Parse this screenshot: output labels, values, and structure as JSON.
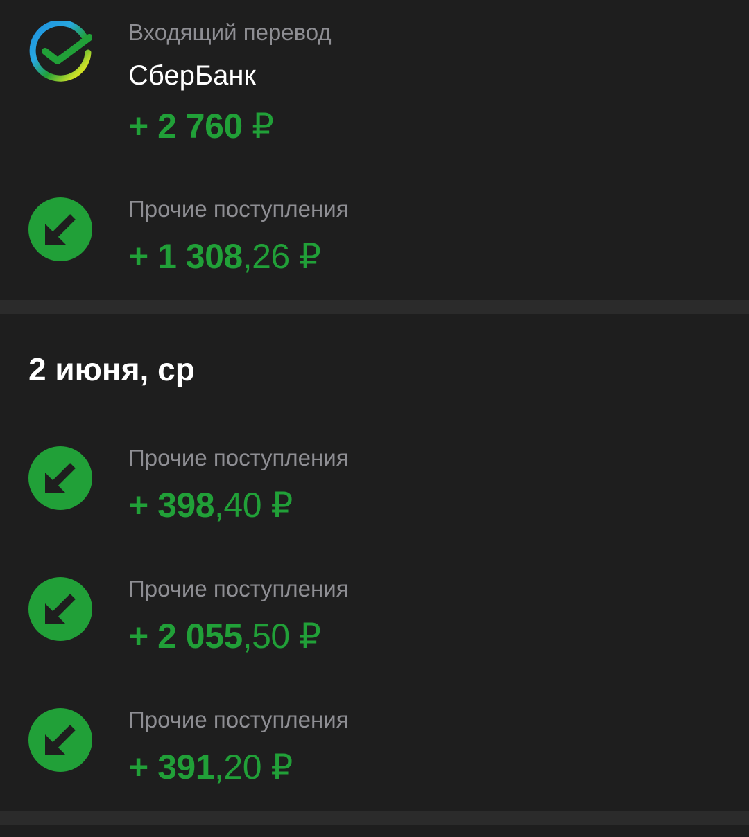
{
  "colors": {
    "background": "#1e1e1e",
    "separator": "#2b2b2b",
    "income_green": "#21a038",
    "secondary_text": "#8e8e93",
    "primary_text": "#ffffff"
  },
  "group_top": {
    "transactions": [
      {
        "icon": "sberbank-logo-icon",
        "category": "Входящий перевод",
        "name": "СберБанк",
        "amount_int": "+ 2 760",
        "amount_frac": "",
        "currency": "₽"
      },
      {
        "icon": "incoming-arrow-icon",
        "category": "Прочие поступления",
        "amount_int": "+ 1 308",
        "amount_frac": ",26",
        "currency": "₽"
      }
    ]
  },
  "group_june2": {
    "date": "2 июня, ср",
    "transactions": [
      {
        "icon": "incoming-arrow-icon",
        "category": "Прочие поступления",
        "amount_int": "+ 398",
        "amount_frac": ",40",
        "currency": "₽"
      },
      {
        "icon": "incoming-arrow-icon",
        "category": "Прочие поступления",
        "amount_int": "+ 2 055",
        "amount_frac": ",50",
        "currency": "₽"
      },
      {
        "icon": "incoming-arrow-icon",
        "category": "Прочие поступления",
        "amount_int": "+ 391",
        "amount_frac": ",20",
        "currency": "₽"
      }
    ]
  }
}
